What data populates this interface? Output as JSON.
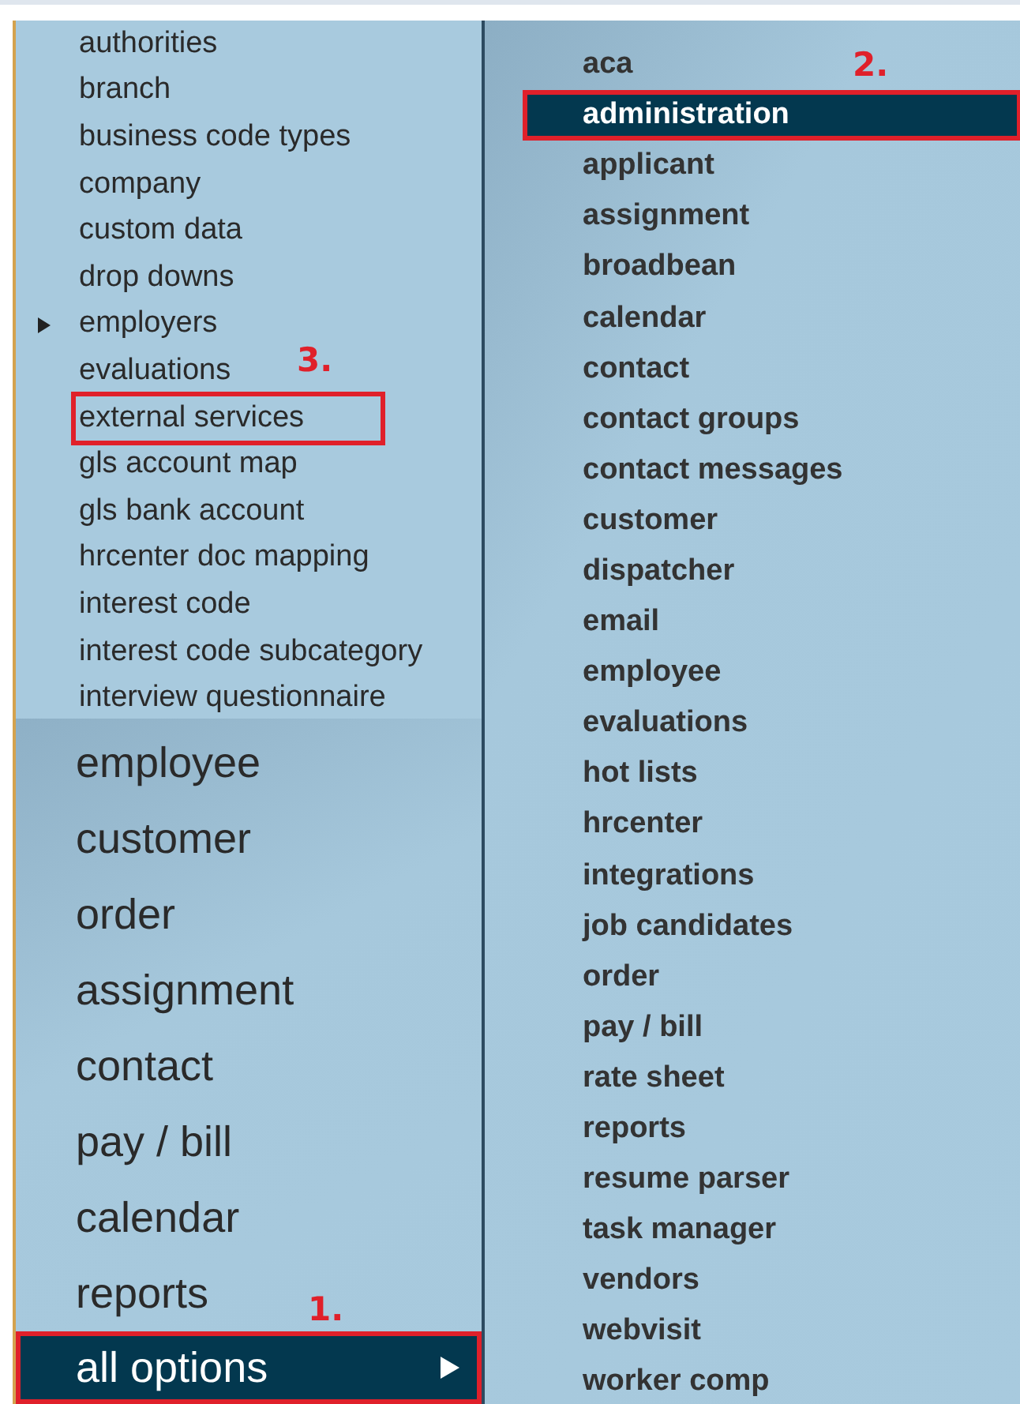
{
  "submenu": {
    "items": [
      {
        "label": "authorities",
        "has_submenu": false
      },
      {
        "label": "branch",
        "has_submenu": false
      },
      {
        "label": "business code types",
        "has_submenu": false
      },
      {
        "label": "company",
        "has_submenu": false
      },
      {
        "label": "custom data",
        "has_submenu": false
      },
      {
        "label": "drop downs",
        "has_submenu": false
      },
      {
        "label": "employers",
        "has_submenu": true
      },
      {
        "label": "evaluations",
        "has_submenu": false
      },
      {
        "label": "external services",
        "has_submenu": false,
        "annotation": "3."
      },
      {
        "label": "gls account map",
        "has_submenu": false
      },
      {
        "label": "gls bank account",
        "has_submenu": false
      },
      {
        "label": "hrcenter doc mapping",
        "has_submenu": false
      },
      {
        "label": "interest code",
        "has_submenu": false
      },
      {
        "label": "interest code subcategory",
        "has_submenu": false
      },
      {
        "label": "interview questionnaire",
        "has_submenu": false
      }
    ]
  },
  "main_menu": {
    "items": [
      {
        "label": "employee",
        "selected": false,
        "has_submenu": false
      },
      {
        "label": "customer",
        "selected": false,
        "has_submenu": false
      },
      {
        "label": "order",
        "selected": false,
        "has_submenu": false
      },
      {
        "label": "assignment",
        "selected": false,
        "has_submenu": false
      },
      {
        "label": "contact",
        "selected": false,
        "has_submenu": false
      },
      {
        "label": "pay / bill",
        "selected": false,
        "has_submenu": false
      },
      {
        "label": "calendar",
        "selected": false,
        "has_submenu": false
      },
      {
        "label": "reports",
        "selected": false,
        "has_submenu": false
      },
      {
        "label": "all options",
        "selected": true,
        "has_submenu": true,
        "annotation": "1."
      }
    ]
  },
  "options_menu": {
    "items": [
      {
        "label": "aca",
        "selected": false
      },
      {
        "label": "administration",
        "selected": true,
        "annotation": "2."
      },
      {
        "label": "applicant",
        "selected": false
      },
      {
        "label": "assignment",
        "selected": false
      },
      {
        "label": "broadbean",
        "selected": false
      },
      {
        "label": "calendar",
        "selected": false
      },
      {
        "label": "contact",
        "selected": false
      },
      {
        "label": "contact groups",
        "selected": false
      },
      {
        "label": "contact messages",
        "selected": false
      },
      {
        "label": "customer",
        "selected": false
      },
      {
        "label": "dispatcher",
        "selected": false
      },
      {
        "label": "email",
        "selected": false
      },
      {
        "label": "employee",
        "selected": false
      },
      {
        "label": "evaluations",
        "selected": false
      },
      {
        "label": "hot lists",
        "selected": false
      },
      {
        "label": "hrcenter",
        "selected": false
      },
      {
        "label": "integrations",
        "selected": false
      },
      {
        "label": "job candidates",
        "selected": false
      },
      {
        "label": "order",
        "selected": false
      },
      {
        "label": "pay / bill",
        "selected": false
      },
      {
        "label": "rate sheet",
        "selected": false
      },
      {
        "label": "reports",
        "selected": false
      },
      {
        "label": "resume parser",
        "selected": false
      },
      {
        "label": "task manager",
        "selected": false
      },
      {
        "label": "vendors",
        "selected": false
      },
      {
        "label": "webvisit",
        "selected": false
      },
      {
        "label": "worker comp",
        "selected": false
      }
    ]
  }
}
